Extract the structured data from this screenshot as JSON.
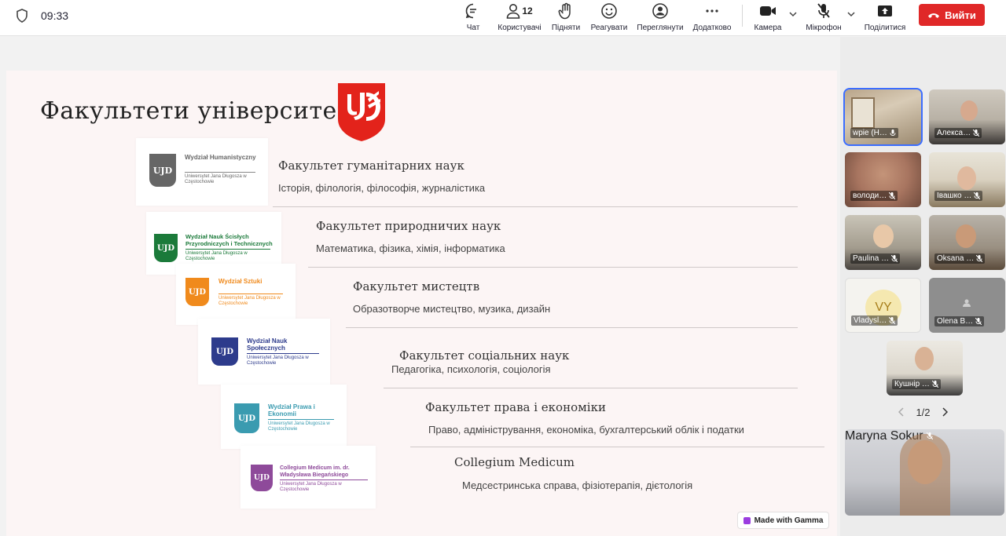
{
  "status": {
    "time": "09:33"
  },
  "toolbar": {
    "chat": "Чат",
    "participants": "Користувачі",
    "participants_count": "12",
    "raise": "Підняти",
    "react": "Реагувати",
    "view": "Переглянути",
    "more": "Додатково",
    "camera": "Камера",
    "mic": "Мікрофон",
    "share": "Поділитися",
    "leave": "Вийти"
  },
  "colors": {
    "leave": "#e02828",
    "accent": "#3b6dff",
    "ujd_red": "#e3231b"
  },
  "slide": {
    "title": "Факультети університету",
    "logo_text": "UJD",
    "faculties": [
      {
        "name": "Факультет гуманітарних наук",
        "desc": "Історія, філологія, філософія, журналістика",
        "badge": {
          "title": "Wydział Humanistyczny",
          "sub": "Uniwersytet Jana Długosza w Częstochowie",
          "color": "#666666"
        }
      },
      {
        "name": "Факультет природничих наук",
        "desc": "Математика, фізика, хімія, інформатика",
        "badge": {
          "title": "Wydział Nauk Ścisłych Przyrodniczych i Technicznych",
          "sub": "Uniwersytet Jana Długosza w Częstochowie",
          "color": "#1b7a3a"
        }
      },
      {
        "name": "Факультет мистецтв",
        "desc": "Образотворче мистецтво, музика, дизайн",
        "badge": {
          "title": "Wydział Sztuki",
          "sub": "Uniwersytet Jana Długosza w Częstochowie",
          "color": "#f08a1c"
        }
      },
      {
        "name": "Факультет соціальних наук",
        "desc": "Педагогіка, психологія, соціологія",
        "badge": {
          "title": "Wydział Nauk Społecznych",
          "sub": "Uniwersytet Jana Długosza w Częstochowie",
          "color": "#2d3b8c"
        }
      },
      {
        "name": "Факультет права і економіки",
        "desc": "Право, адміністрування, економіка, бухгалтерський облік і податки",
        "badge": {
          "title": "Wydział Prawa i Ekonomii",
          "sub": "Uniwersytet Jana Długosza w Częstochowie",
          "color": "#3a9bb0"
        }
      },
      {
        "name": "Collegium Medicum",
        "desc": "Медсестринська справа, фізіотерапія, дієтологія",
        "badge": {
          "title": "Collegium Medicum im. dr. Władysława Biegańskiego",
          "sub": "Uniwersytet Jana Długosza w Częstochowie",
          "color": "#8e4a9a"
        }
      }
    ],
    "made_with": "Made with Gamma"
  },
  "participants": {
    "tiles": [
      {
        "name": "wpie  (H…",
        "icon": "mic-on-icon"
      },
      {
        "name": "Алекса…",
        "icon": "mic-muted-icon"
      },
      {
        "name": "володи…",
        "icon": "mic-muted-icon"
      },
      {
        "name": "Івашко …",
        "icon": "mic-muted-icon"
      },
      {
        "name": "Paulina …",
        "icon": "mic-muted-icon"
      },
      {
        "name": "Oksana …",
        "icon": "mic-muted-icon"
      },
      {
        "name": "Vladysl…",
        "initials": "VY",
        "icon": "mic-muted-icon"
      },
      {
        "name": "Olena B…",
        "icon": "mic-muted-icon"
      },
      {
        "name": "Кушнір …",
        "icon": "mic-muted-icon"
      }
    ],
    "page": "1/2",
    "self": {
      "name": "Maryna Sokur"
    }
  }
}
